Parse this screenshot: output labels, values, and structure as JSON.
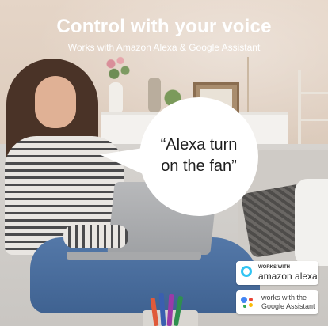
{
  "header": {
    "title": "Control with your voice",
    "subtitle": "Works with Amazon Alexa & Google Assistant"
  },
  "speech_bubble": {
    "line1": "“Alexa turn",
    "line2": "on the fan”"
  },
  "badges": {
    "alexa": {
      "small": "WORKS WITH",
      "big": "amazon alexa",
      "accent": "#31c4f3"
    },
    "google": {
      "line1": "works with the",
      "line2": "Google Assistant",
      "dot_colors": [
        "#4285f4",
        "#ea4335",
        "#fbbc05",
        "#34a853"
      ]
    }
  },
  "colors": {
    "title_text": "#ffffff",
    "bubble_bg": "#ffffff"
  }
}
